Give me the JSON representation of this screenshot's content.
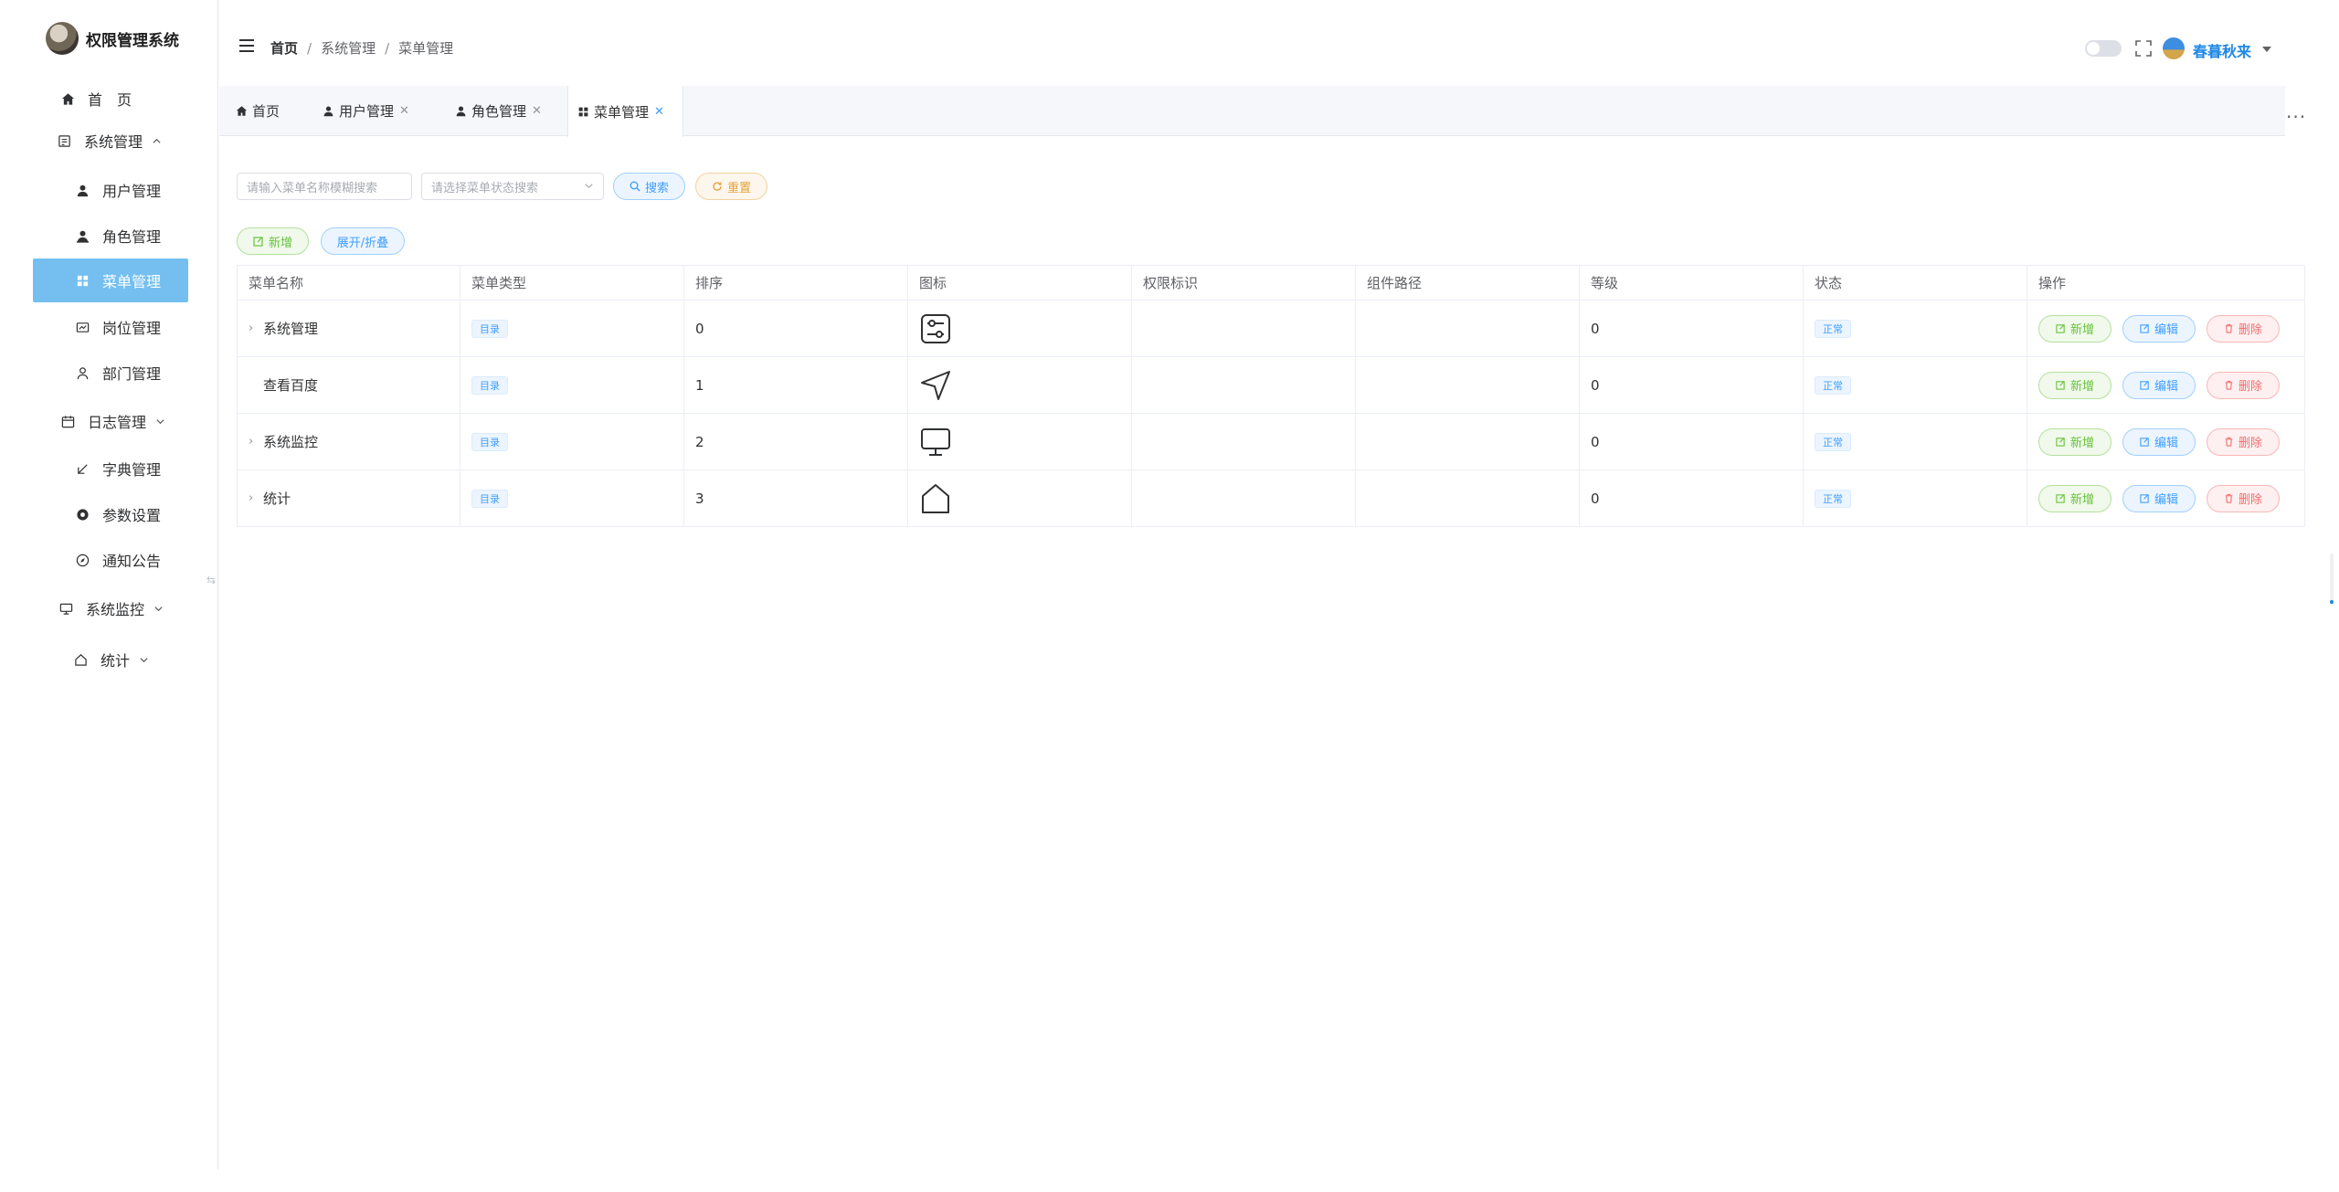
{
  "app": {
    "title": "权限管理系统"
  },
  "sidebar": {
    "items": [
      {
        "label": "首　页"
      },
      {
        "label": "系统管理"
      },
      {
        "label": "用户管理"
      },
      {
        "label": "角色管理"
      },
      {
        "label": "菜单管理"
      },
      {
        "label": "岗位管理"
      },
      {
        "label": "部门管理"
      },
      {
        "label": "日志管理"
      },
      {
        "label": "字典管理"
      },
      {
        "label": "参数设置"
      },
      {
        "label": "通知公告"
      },
      {
        "label": "系统监控"
      },
      {
        "label": "统计"
      }
    ],
    "active": "菜单管理",
    "accent": "#74bff0"
  },
  "header": {
    "breadcrumb": [
      "首页",
      "系统管理",
      "菜单管理"
    ],
    "separator": "/",
    "user_name": "春暮秋来"
  },
  "tabs": [
    {
      "label": "首页",
      "icon": "home-icon",
      "closable": false
    },
    {
      "label": "用户管理",
      "icon": "user-icon",
      "closable": true
    },
    {
      "label": "角色管理",
      "icon": "role-icon",
      "closable": true
    },
    {
      "label": "菜单管理",
      "icon": "grid-icon",
      "closable": true,
      "active": true
    }
  ],
  "search": {
    "name_placeholder": "请输入菜单名称模糊搜索",
    "status_placeholder": "请选择菜单状态搜索",
    "search_label": "搜索",
    "reset_label": "重置"
  },
  "toolbar": {
    "add_label": "新增",
    "expand_label": "展开/折叠"
  },
  "table": {
    "columns": [
      "菜单名称",
      "菜单类型",
      "排序",
      "图标",
      "权限标识",
      "组件路径",
      "等级",
      "状态",
      "操作"
    ],
    "rows": [
      {
        "name": "系统管理",
        "expandable": true,
        "type": "目录",
        "order": "0",
        "icon": "settings-panel-icon",
        "perm": "",
        "path": "",
        "level": "0",
        "status": "正常"
      },
      {
        "name": "查看百度",
        "expandable": false,
        "type": "目录",
        "order": "1",
        "icon": "navigation-arrow-icon",
        "perm": "",
        "path": "",
        "level": "0",
        "status": "正常"
      },
      {
        "name": "系统监控",
        "expandable": true,
        "type": "目录",
        "order": "2",
        "icon": "monitor-icon",
        "perm": "",
        "path": "",
        "level": "0",
        "status": "正常"
      },
      {
        "name": "统计",
        "expandable": true,
        "type": "目录",
        "order": "3",
        "icon": "house-icon",
        "perm": "",
        "path": "",
        "level": "0",
        "status": "正常"
      }
    ],
    "actions": {
      "add": "新增",
      "edit": "编辑",
      "delete": "删除"
    }
  },
  "colors": {
    "primary": "#409eff",
    "success": "#67c23a",
    "warning": "#e6a23c",
    "danger": "#f56c6c"
  }
}
